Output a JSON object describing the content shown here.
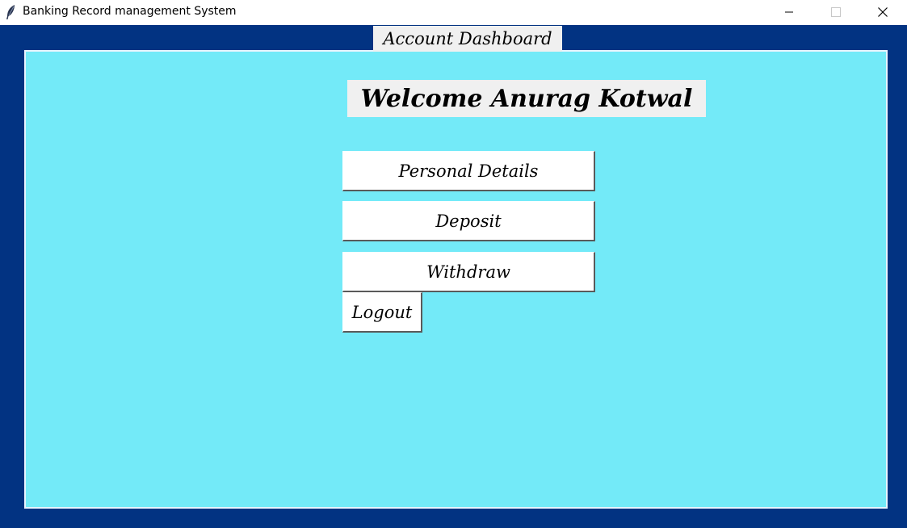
{
  "window": {
    "title": "Banking Record management System",
    "icon": "feather-icon",
    "controls": {
      "minimize_icon": "minimize-icon",
      "maximize_icon": "maximize-icon",
      "close_icon": "close-icon"
    }
  },
  "dashboard": {
    "heading": "Account Dashboard",
    "welcome": "Welcome Anurag Kotwal",
    "buttons": {
      "personal_details": "Personal Details",
      "deposit": "Deposit",
      "withdraw": "Withdraw",
      "logout": "Logout"
    }
  },
  "colors": {
    "outer_background": "#023382",
    "panel_background": "#73eaf8",
    "label_background": "#f0f0f0",
    "button_background": "#ffffff"
  }
}
